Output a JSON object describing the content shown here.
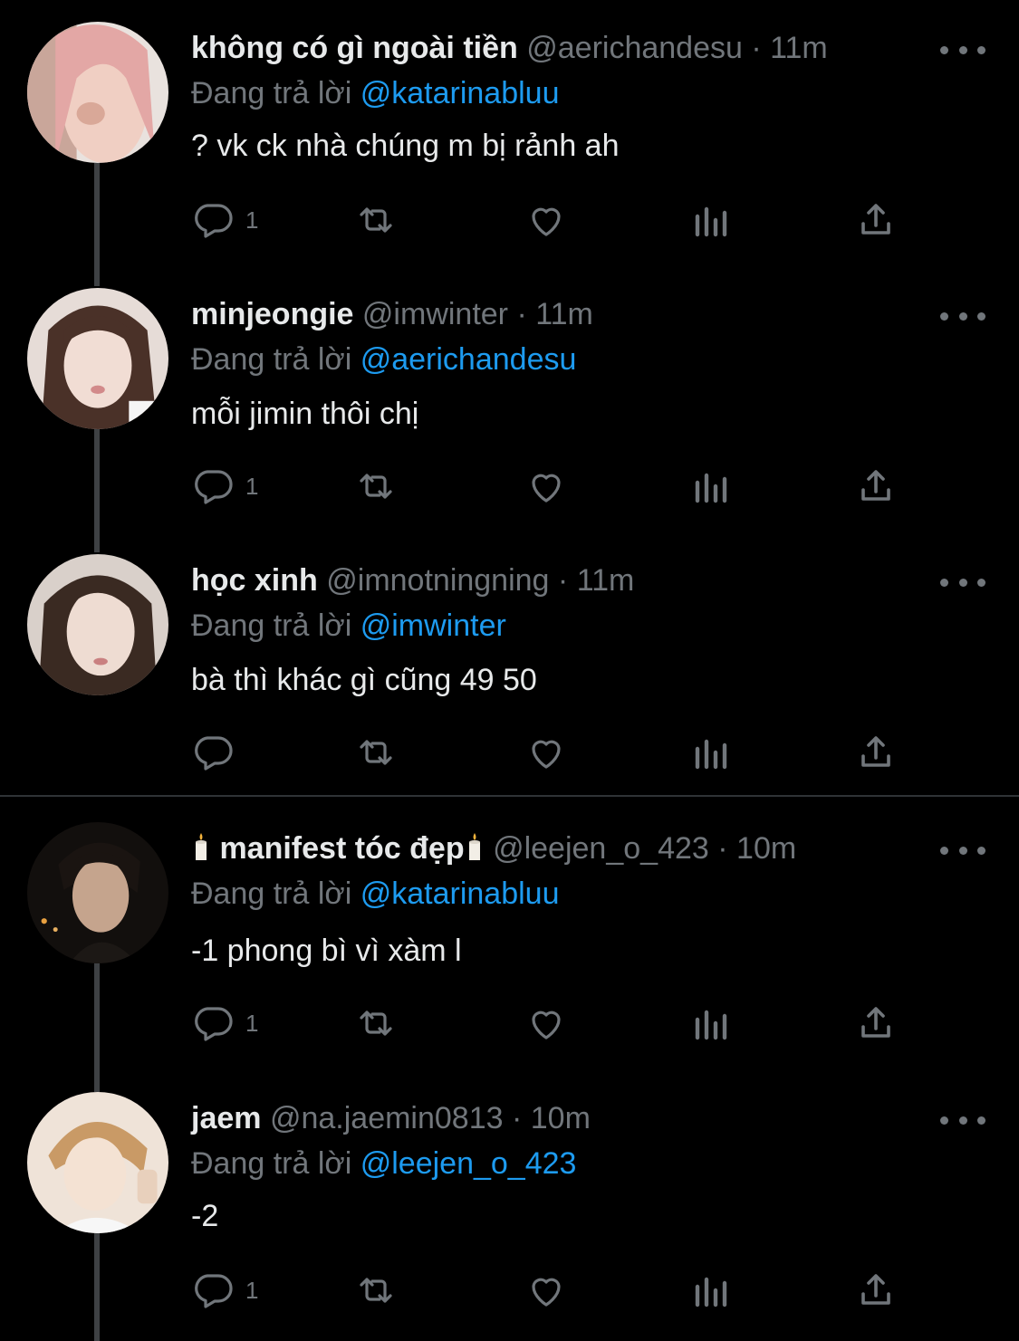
{
  "tweets": [
    {
      "display_name": "không có gì ngoài tiền",
      "handle": "@aerichandesu",
      "time": "11m",
      "replying_prefix": "Đang trả lời",
      "replying_to": "@katarinabluu",
      "text": "? vk ck nhà chúng m bị rảnh ah",
      "reply_count": "1",
      "avatar_colors": [
        "#e7b7a9",
        "#8a5a50"
      ]
    },
    {
      "display_name": "minjeongie",
      "handle": "@imwinter",
      "time": "11m",
      "replying_prefix": "Đang trả lời",
      "replying_to": "@aerichandesu",
      "text": "mỗi jimin thôi chị",
      "reply_count": "1",
      "avatar_colors": [
        "#d8c4bd",
        "#3b2a25"
      ]
    },
    {
      "display_name": "học xinh",
      "handle": "@imnotningning",
      "time": "11m",
      "replying_prefix": "Đang trả lời",
      "replying_to": "@imwinter",
      "text": "bà thì khác gì cũng 49 50",
      "reply_count": "",
      "avatar_colors": [
        "#c9b8ae",
        "#2a211d"
      ]
    },
    {
      "display_name": "manifest tóc đẹp",
      "handle": "@leejen_o_423",
      "time": "10m",
      "replying_prefix": "Đang trả lời",
      "replying_to": "@katarinabluu",
      "text": "-1 phong bì vì xàm l",
      "reply_count": "1",
      "avatar_colors": [
        "#b89a85",
        "#0f0c0b"
      ]
    },
    {
      "display_name": "jaem",
      "handle": "@na.jaemin0813",
      "time": "10m",
      "replying_prefix": "Đang trả lời",
      "replying_to": "@leejen_o_423",
      "text": "-2",
      "reply_count": "1",
      "avatar_colors": [
        "#ecd9c8",
        "#b58a5c"
      ]
    }
  ],
  "colors": {
    "background": "#000000",
    "primary_text": "#E7E9EA",
    "secondary_text": "#71767B",
    "accent": "#1D9BF0",
    "thread_line": "#3E4144"
  },
  "icons": [
    "reply-icon",
    "retweet-icon",
    "like-icon",
    "views-icon",
    "share-icon",
    "more-icon",
    "candle-emoji"
  ]
}
